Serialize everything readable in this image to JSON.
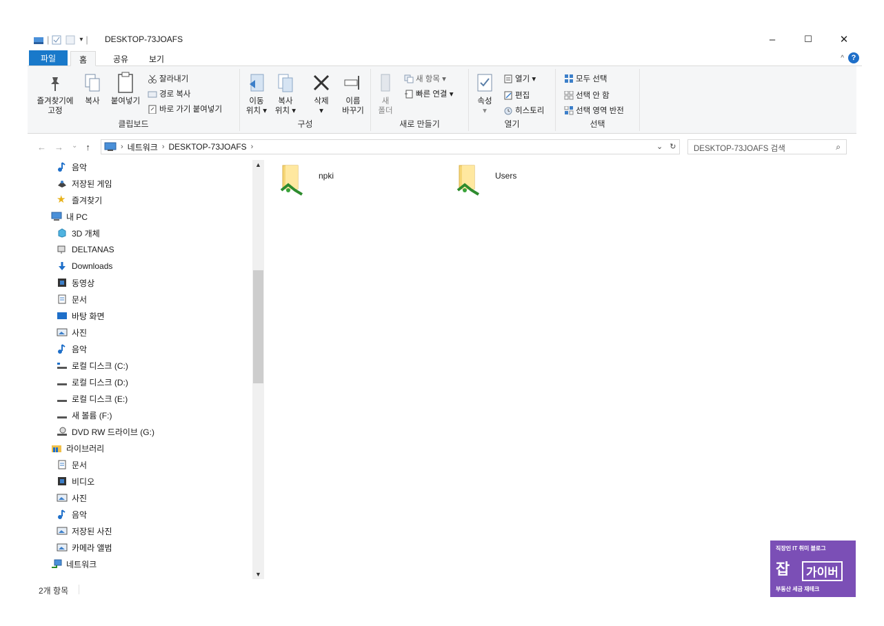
{
  "window": {
    "title": "DESKTOP-73JOAFS",
    "minimize": "–",
    "maximize": "☐",
    "close": "✕"
  },
  "ribbon": {
    "tabs": [
      "파일",
      "홈",
      "공유",
      "보기"
    ],
    "clipboard": {
      "pin_line1": "즐겨찾기에",
      "pin_line2": "고정",
      "copy": "복사",
      "paste": "붙여넣기",
      "cut": "잘라내기",
      "copy_path": "경로 복사",
      "paste_shortcut": "바로 가기 붙여넣기",
      "label": "클립보드"
    },
    "organize": {
      "move_line1": "이동",
      "move_line2": "위치 ▾",
      "copyto_line1": "복사",
      "copyto_line2": "위치 ▾",
      "delete_line1": "삭제",
      "delete_line2": "▾",
      "rename_line1": "이름",
      "rename_line2": "바꾸기",
      "label": "구성"
    },
    "new": {
      "folder_line1": "새",
      "folder_line2": "폴더",
      "new_item": "새 항목 ▾",
      "easy_access": "빠른 연결 ▾",
      "label": "새로 만들기"
    },
    "open": {
      "properties_line1": "속성",
      "properties_line2": "▾",
      "open": "열기 ▾",
      "edit": "편집",
      "history": "히스토리",
      "label": "열기"
    },
    "select": {
      "select_all": "모두 선택",
      "select_none": "선택 안 함",
      "invert": "선택 영역 반전",
      "label": "선택"
    }
  },
  "address": {
    "segments": [
      "네트워크",
      "DESKTOP-73JOAFS"
    ],
    "search_placeholder": "DESKTOP-73JOAFS 검색"
  },
  "nav": {
    "items": [
      {
        "label": "음악",
        "icon": "music-icon"
      },
      {
        "label": "저장된 게임",
        "icon": "games-icon"
      },
      {
        "label": "즐겨찾기",
        "icon": "star-icon"
      },
      {
        "label": "내 PC",
        "icon": "pc-icon"
      },
      {
        "label": "3D 개체",
        "icon": "cube-icon"
      },
      {
        "label": "DELTANAS",
        "icon": "network-drive-icon"
      },
      {
        "label": "Downloads",
        "icon": "download-icon"
      },
      {
        "label": "동영상",
        "icon": "video-icon"
      },
      {
        "label": "문서",
        "icon": "document-icon"
      },
      {
        "label": "바탕 화면",
        "icon": "desktop-icon"
      },
      {
        "label": "사진",
        "icon": "pictures-icon"
      },
      {
        "label": "음악",
        "icon": "music-icon"
      },
      {
        "label": "로컬 디스크 (C:)",
        "icon": "drive-icon"
      },
      {
        "label": "로컬 디스크 (D:)",
        "icon": "drive-icon"
      },
      {
        "label": "로컬 디스크 (E:)",
        "icon": "drive-icon"
      },
      {
        "label": "새 볼륨 (F:)",
        "icon": "drive-icon"
      },
      {
        "label": "DVD RW 드라이브 (G:)",
        "icon": "dvd-icon"
      },
      {
        "label": "라이브러리",
        "icon": "library-icon"
      },
      {
        "label": "문서",
        "icon": "document-icon"
      },
      {
        "label": "비디오",
        "icon": "video-icon"
      },
      {
        "label": "사진",
        "icon": "pictures-icon"
      },
      {
        "label": "음악",
        "icon": "music-icon"
      },
      {
        "label": "저장된 사진",
        "icon": "pictures-icon"
      },
      {
        "label": "카메라 앨범",
        "icon": "pictures-icon"
      },
      {
        "label": "네트워크",
        "icon": "network-icon"
      }
    ]
  },
  "content": {
    "items": [
      {
        "name": "npki",
        "icon": "shared-folder-icon"
      },
      {
        "name": "Users",
        "icon": "shared-folder-icon"
      }
    ]
  },
  "status": {
    "count": "2개 항목"
  },
  "watermark": {
    "top": "직장인 IT 취미 블로그",
    "main1": "잡",
    "main2": "가이버",
    "bottom": "부동산 세금 재테크"
  },
  "colors": {
    "accent": "#1979ca",
    "ribbon_bg": "#f5f6f7",
    "watermark": "#7b4fb6"
  }
}
